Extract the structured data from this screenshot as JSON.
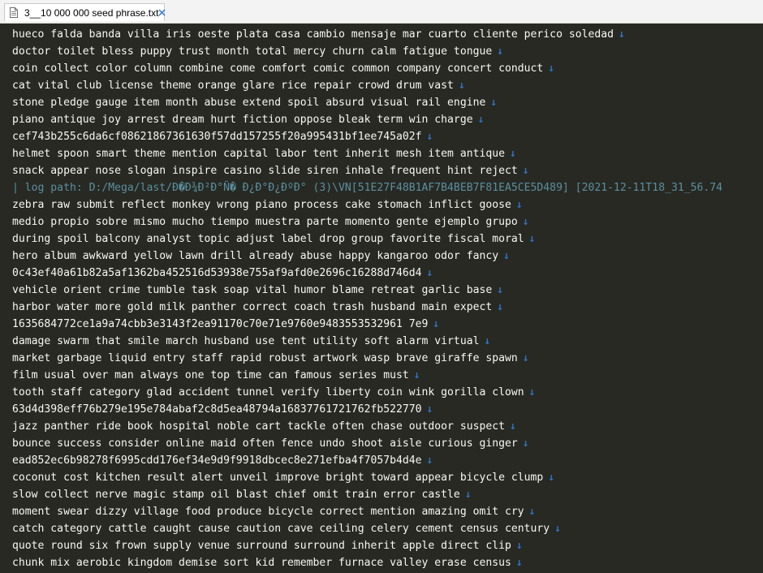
{
  "tab": {
    "title": "3__10 000 000 seed phrase.txt",
    "close_glyph": "×",
    "icon": "text-file-icon"
  },
  "editor": {
    "eol_glyph": "↓",
    "lines": [
      {
        "text": "hueco falda banda villa iris oeste plata casa cambio mensaje mar cuarto cliente perico soledad",
        "eol": true
      },
      {
        "text": "doctor toilet bless puppy trust month total mercy churn calm fatigue tongue",
        "eol": true
      },
      {
        "text": "coin collect color column combine come comfort comic common company concert conduct",
        "eol": true
      },
      {
        "text": "cat vital club license theme orange glare rice repair crowd drum vast",
        "eol": true
      },
      {
        "text": "stone pledge gauge item month abuse extend spoil absurd visual rail engine",
        "eol": true
      },
      {
        "text": "piano antique joy arrest dream hurt fiction oppose bleak term win charge",
        "eol": true
      },
      {
        "text": "cef743b255c6da6cf08621867361630f57dd157255f20a995431bf1ee745a02f",
        "eol": true
      },
      {
        "text": "helmet spoon smart theme mention capital labor tent inherit mesh item antique",
        "eol": true
      },
      {
        "text": "snack appear nose slogan inspire casino slide siren inhale frequent hint reject",
        "eol": true
      },
      {
        "text": "| log path: D:/Mega/last/Ð�Ð¾Ð²Ð°Ñ� Ð¿Ð°Ð¿ÐºÐ° (3)\\VN[51E27F48B1AF7B4BEB7F81EA5CE5D489] [2021-12-11T18_31_56.74",
        "eol": false,
        "comment": true
      },
      {
        "text": "zebra raw submit reflect monkey wrong piano process cake stomach inflict goose",
        "eol": true
      },
      {
        "text": "medio propio sobre mismo mucho tiempo muestra parte momento gente ejemplo grupo",
        "eol": true
      },
      {
        "text": "during spoil balcony analyst topic adjust label drop group favorite fiscal moral",
        "eol": true
      },
      {
        "text": "hero album awkward yellow lawn drill already abuse happy kangaroo odor fancy",
        "eol": true
      },
      {
        "text": "0c43ef40a61b82a5af1362ba452516d53938e755af9afd0e2696c16288d746d4",
        "eol": true
      },
      {
        "text": "vehicle orient crime tumble task soap vital humor blame retreat garlic base",
        "eol": true
      },
      {
        "text": "harbor water more gold milk panther correct coach trash husband main expect",
        "eol": true
      },
      {
        "text": "1635684772ce1a9a74cbb3e3143f2ea91170c70e71e9760e9483553532961 7e9",
        "eol": true
      },
      {
        "text": "damage swarm that smile march husband use tent utility soft alarm virtual",
        "eol": true
      },
      {
        "text": "market garbage liquid entry staff rapid robust artwork wasp brave giraffe spawn",
        "eol": true
      },
      {
        "text": "film usual over man always one top time can famous series must",
        "eol": true
      },
      {
        "text": "tooth staff category glad accident tunnel verify liberty coin wink gorilla clown",
        "eol": true
      },
      {
        "text": "63d4d398eff76b279e195e784abaf2c8d5ea48794a16837761721762fb522770",
        "eol": true
      },
      {
        "text": "jazz panther ride book hospital noble cart tackle often chase outdoor suspect",
        "eol": true
      },
      {
        "text": "bounce success consider online maid often fence undo shoot aisle curious ginger",
        "eol": true
      },
      {
        "text": "ead852ec6b98278f6995cdd176ef34e9d9f9918dbcec8e271efba4f7057b4d4e",
        "eol": true
      },
      {
        "text": "coconut cost kitchen result alert unveil improve bright toward appear bicycle clump",
        "eol": true
      },
      {
        "text": "slow collect nerve magic stamp oil blast chief omit train error castle",
        "eol": true
      },
      {
        "text": "moment swear dizzy village food produce bicycle correct mention amazing omit cry",
        "eol": true
      },
      {
        "text": "catch category cattle caught cause caution cave ceiling celery cement census century",
        "eol": true
      },
      {
        "text": "quote round six frown supply venue surround surround inherit apple direct clip",
        "eol": true
      },
      {
        "text": "chunk mix aerobic kingdom demise sort kid remember furnace valley erase census",
        "eol": true
      }
    ]
  }
}
